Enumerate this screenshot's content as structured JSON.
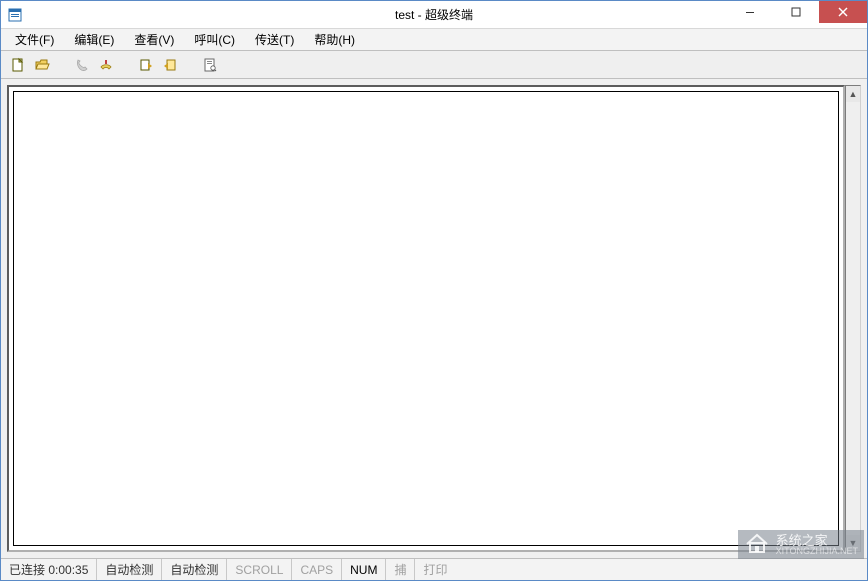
{
  "window": {
    "title": "test - 超级终端"
  },
  "menu": {
    "file": "文件(F)",
    "edit": "编辑(E)",
    "view": "查看(V)",
    "call": "呼叫(C)",
    "transfer": "传送(T)",
    "help": "帮助(H)"
  },
  "toolbar_icons": {
    "new": "new",
    "open": "open",
    "call": "call",
    "hangup": "hangup",
    "send": "send",
    "receive": "receive",
    "properties": "properties"
  },
  "status": {
    "connection": "已连接 0:00:35",
    "detect1": "自动检测",
    "detect2": "自动检测",
    "scroll": "SCROLL",
    "caps": "CAPS",
    "num": "NUM",
    "capture": "捕",
    "print": "打印"
  },
  "watermark": {
    "text": "系统之家",
    "sub": "XITONGZHIJIA.NET"
  }
}
